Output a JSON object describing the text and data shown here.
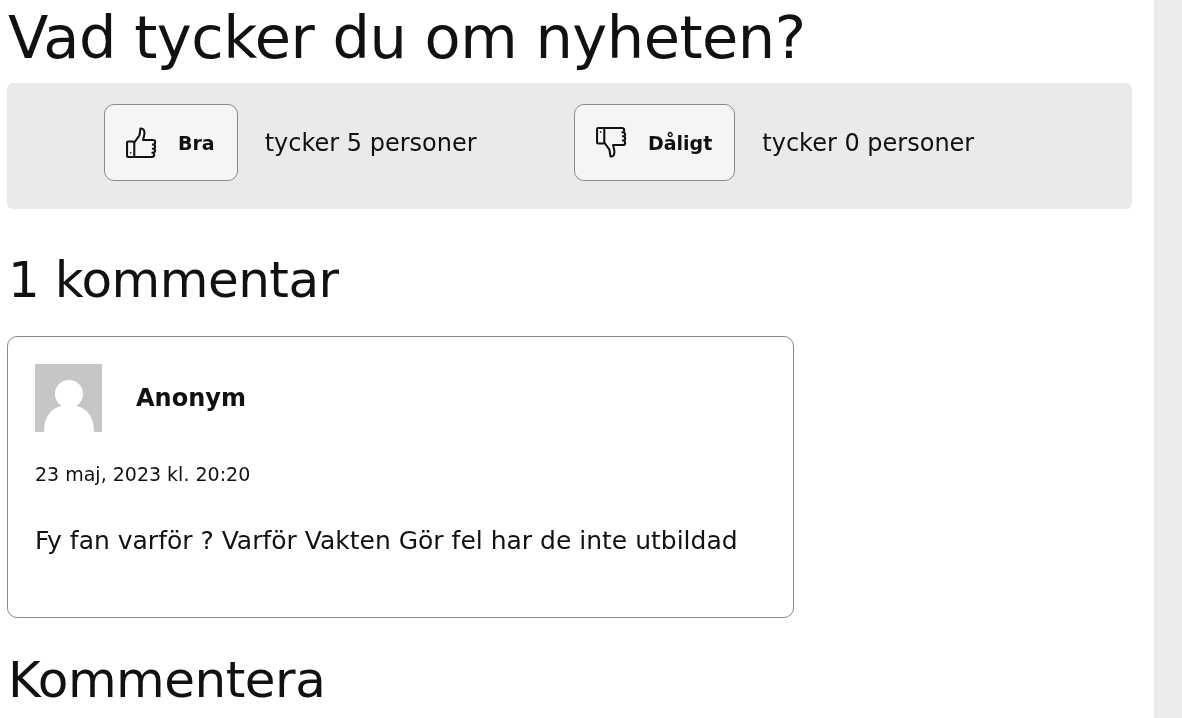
{
  "poll": {
    "question": "Vad tycker du om nyheten?",
    "options": [
      {
        "kind": "up",
        "label": "Bra",
        "count_text": "tycker 5 personer"
      },
      {
        "kind": "down",
        "label": "Dåligt",
        "count_text": "tycker 0 personer"
      }
    ]
  },
  "comments": {
    "heading": "1 kommentar",
    "items": [
      {
        "author": "Anonym",
        "date": "23 maj, 2023 kl. 20:20",
        "text": "Fy fan varför ? Varför Vakten Gör fel har de inte utbildad"
      }
    ]
  },
  "form": {
    "heading": "Kommentera"
  }
}
